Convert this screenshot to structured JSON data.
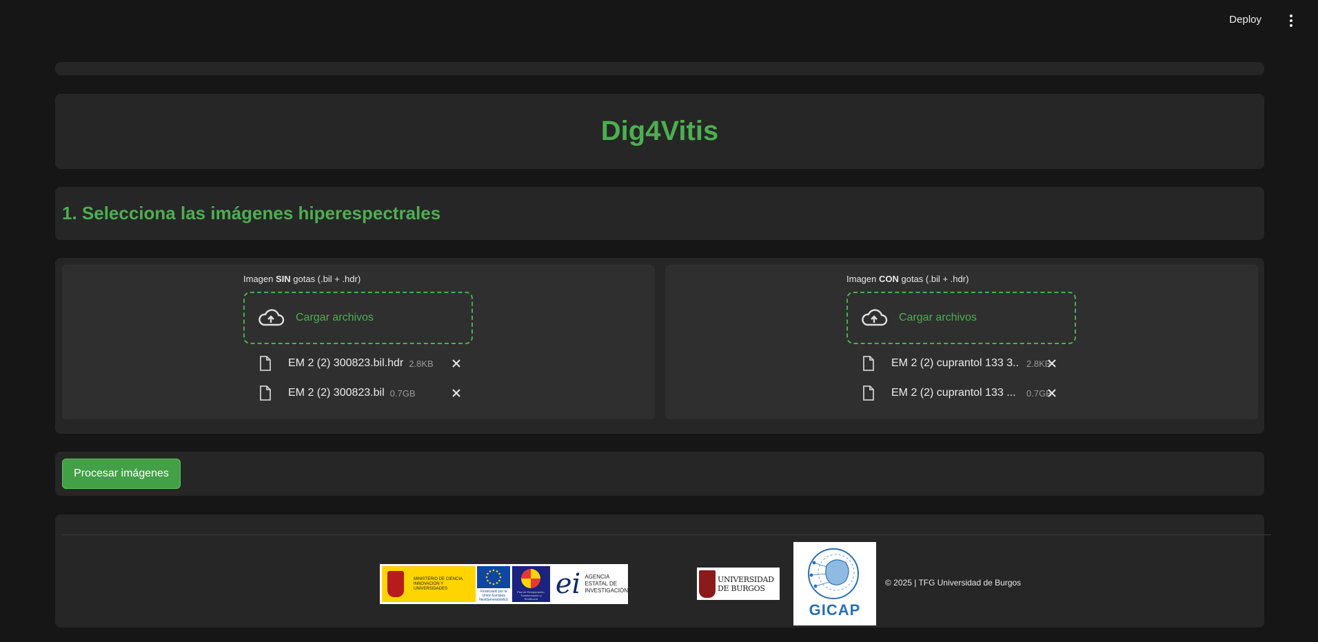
{
  "header": {
    "deploy_label": "Deploy",
    "menu_icon": "kebab-menu-icon"
  },
  "app": {
    "title": "Dig4Vitis"
  },
  "section": {
    "title": "1. Selecciona las imágenes hiperespectrales"
  },
  "uploads": {
    "left": {
      "label_prefix": "Imagen ",
      "label_bold": "SIN",
      "label_suffix": " gotas (.bil + .hdr)",
      "drop_label": "Cargar archivos",
      "files": [
        {
          "name": "EM 2 (2) 300823.bil.hdr",
          "size": "2.8KB"
        },
        {
          "name": "EM 2 (2) 300823.bil",
          "size": "0.7GB"
        }
      ]
    },
    "right": {
      "label_prefix": "Imagen ",
      "label_bold": "CON",
      "label_suffix": " gotas (.bil + .hdr)",
      "drop_label": "Cargar archivos",
      "files": [
        {
          "name": "EM 2 (2) cuprantol 133 3...",
          "size": "2.8KB"
        },
        {
          "name": "EM 2 (2) cuprantol 133 ...",
          "size": "0.7GB"
        }
      ]
    }
  },
  "actions": {
    "process_label": "Procesar imágenes"
  },
  "footer": {
    "logos": {
      "ministerio": "MINISTERIO DE CIENCIA, INNOVACIÓN Y UNIVERSIDADES",
      "eu": "Financiado por la Unión Europea NextGenerationEU",
      "prtr": "Plan de Recuperación, Transformación y Resiliencia",
      "aei_line1": "AGENCIA",
      "aei_line2": "ESTATAL DE",
      "aei_line3": "INVESTIGACIÓN",
      "ubu_line1": "UNIVERSIDAD",
      "ubu_line2": "DE BURGOS",
      "gicap": "GICAP"
    },
    "copyright": "© 2025 | TFG Universidad de Burgos"
  },
  "colors": {
    "accent": "#4caf50",
    "background": "#161616",
    "panel": "#262626"
  }
}
